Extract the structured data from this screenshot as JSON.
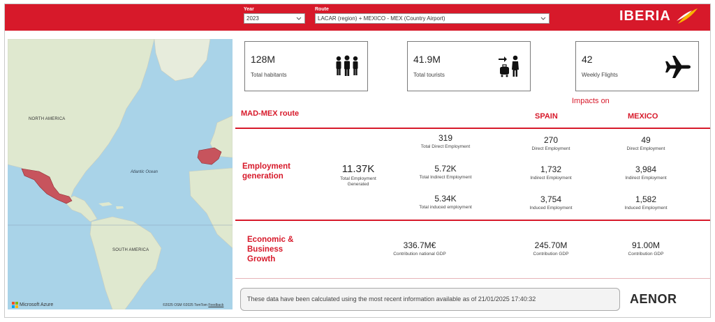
{
  "header": {
    "year_label": "Year",
    "year_value": "2023",
    "route_label": "Route",
    "route_value": "LACAR (region) + MEXICO - MEX (Country Airport)",
    "logo_text": "IBERIA",
    "colors": {
      "brand_red": "#d7192a",
      "logo_yellow": "#f8b500"
    }
  },
  "map": {
    "labels": {
      "north_america": "NORTH AMERICA",
      "atlantic": "Atlantic Ocean",
      "south_america": "SOUTH AMERICA"
    },
    "provider": "Microsoft Azure",
    "copyright": "©2025 OSM  ©2025 TomTom",
    "feedback": "Feedback",
    "colors": {
      "water": "#a9d3e8",
      "land": "#dfe8cf",
      "highlight": "#c7545d"
    }
  },
  "kpis": [
    {
      "value": "128M",
      "label": "Total habitants",
      "icon": "people-group-icon"
    },
    {
      "value": "41.9M",
      "label": "Total tourists",
      "icon": "tourist-luggage-icon"
    },
    {
      "value": "42",
      "label": "Weekly Flights",
      "icon": "airplane-icon"
    }
  ],
  "table": {
    "route_title": "MAD-MEX route",
    "impacts_on": "Impacts on",
    "col_spain": "SPAIN",
    "col_mexico": "MEXICO",
    "employment": {
      "title": "Employment generation",
      "total_value": "11.37K",
      "total_label": "Total Employment Generated",
      "direct_value": "319",
      "direct_label": "Total Direct Employment",
      "indirect_value": "5.72K",
      "indirect_label": "Total Indirect Employment",
      "induced_value": "5.34K",
      "induced_label": "Total induced employment",
      "spain": {
        "direct_value": "270",
        "direct_label": "Direct Employment",
        "indirect_value": "1,732",
        "indirect_label": "Indirect Employment",
        "induced_value": "3,754",
        "induced_label": "Induced Employment"
      },
      "mexico": {
        "direct_value": "49",
        "direct_label": "Direct Employment",
        "indirect_value": "3,984",
        "indirect_label": "Indirect Employment",
        "induced_value": "1,582",
        "induced_label": "Induced Employment"
      }
    },
    "economic": {
      "title": "Economic & Business Growth",
      "national_value": "336.7M€",
      "national_label": "Contribution national GDP",
      "spain_value": "245.70M",
      "spain_label": "Contribution GDP",
      "mexico_value": "91.00M",
      "mexico_label": "Contribution GDP"
    }
  },
  "footer": {
    "note": "These data have been calculated using the most recent information available as of 21/01/2025 17:40:32",
    "certifier": "AENOR"
  }
}
